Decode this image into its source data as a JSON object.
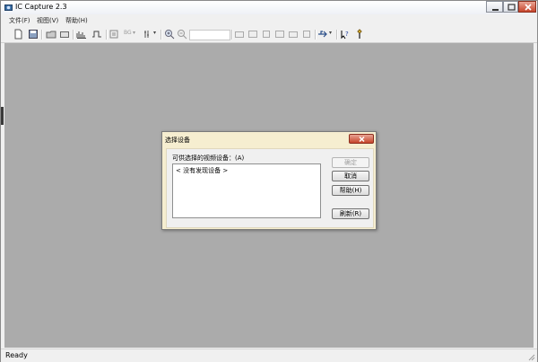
{
  "window": {
    "title": "IC Capture 2.3",
    "icons": {
      "app": "camera-app-icon",
      "minimize": "minimize-icon",
      "maximize": "maximize-icon",
      "close": "close-icon"
    }
  },
  "menu": {
    "items": [
      {
        "label": "文件(F)"
      },
      {
        "label": "视图(V)"
      },
      {
        "label": "帮助(H)"
      }
    ]
  },
  "toolbar": {
    "zoom_value": "",
    "bg_label": "BG",
    "icons": [
      "new-icon",
      "save-icon",
      "open-icon",
      "open-folder-icon",
      "histogram-icon",
      "waveform-icon",
      "fullscreen-icon",
      "bg-icon",
      "properties-icon",
      "zoom-in-icon",
      "zoom-out-icon",
      "snapshot-icon",
      "record-icon",
      "capture-icon",
      "frame-icon",
      "export-icon",
      "settings-icon",
      "usb-device-icon",
      "whats-this-help-icon",
      "info-icon"
    ]
  },
  "status": {
    "text": "Ready"
  },
  "dialog": {
    "title": "选择设备",
    "list_label": "可供选择的视频设备：(A)",
    "list_items": [
      "< 没有发现设备 >"
    ],
    "buttons": {
      "ok": "确定",
      "cancel": "取消",
      "help": "帮助(H)",
      "refresh": "刷新(R)"
    },
    "ok_enabled": false
  },
  "colors": {
    "workspace": "#ababab",
    "dialog_frame": "#f6eed0",
    "close_button": "#c6452b"
  }
}
